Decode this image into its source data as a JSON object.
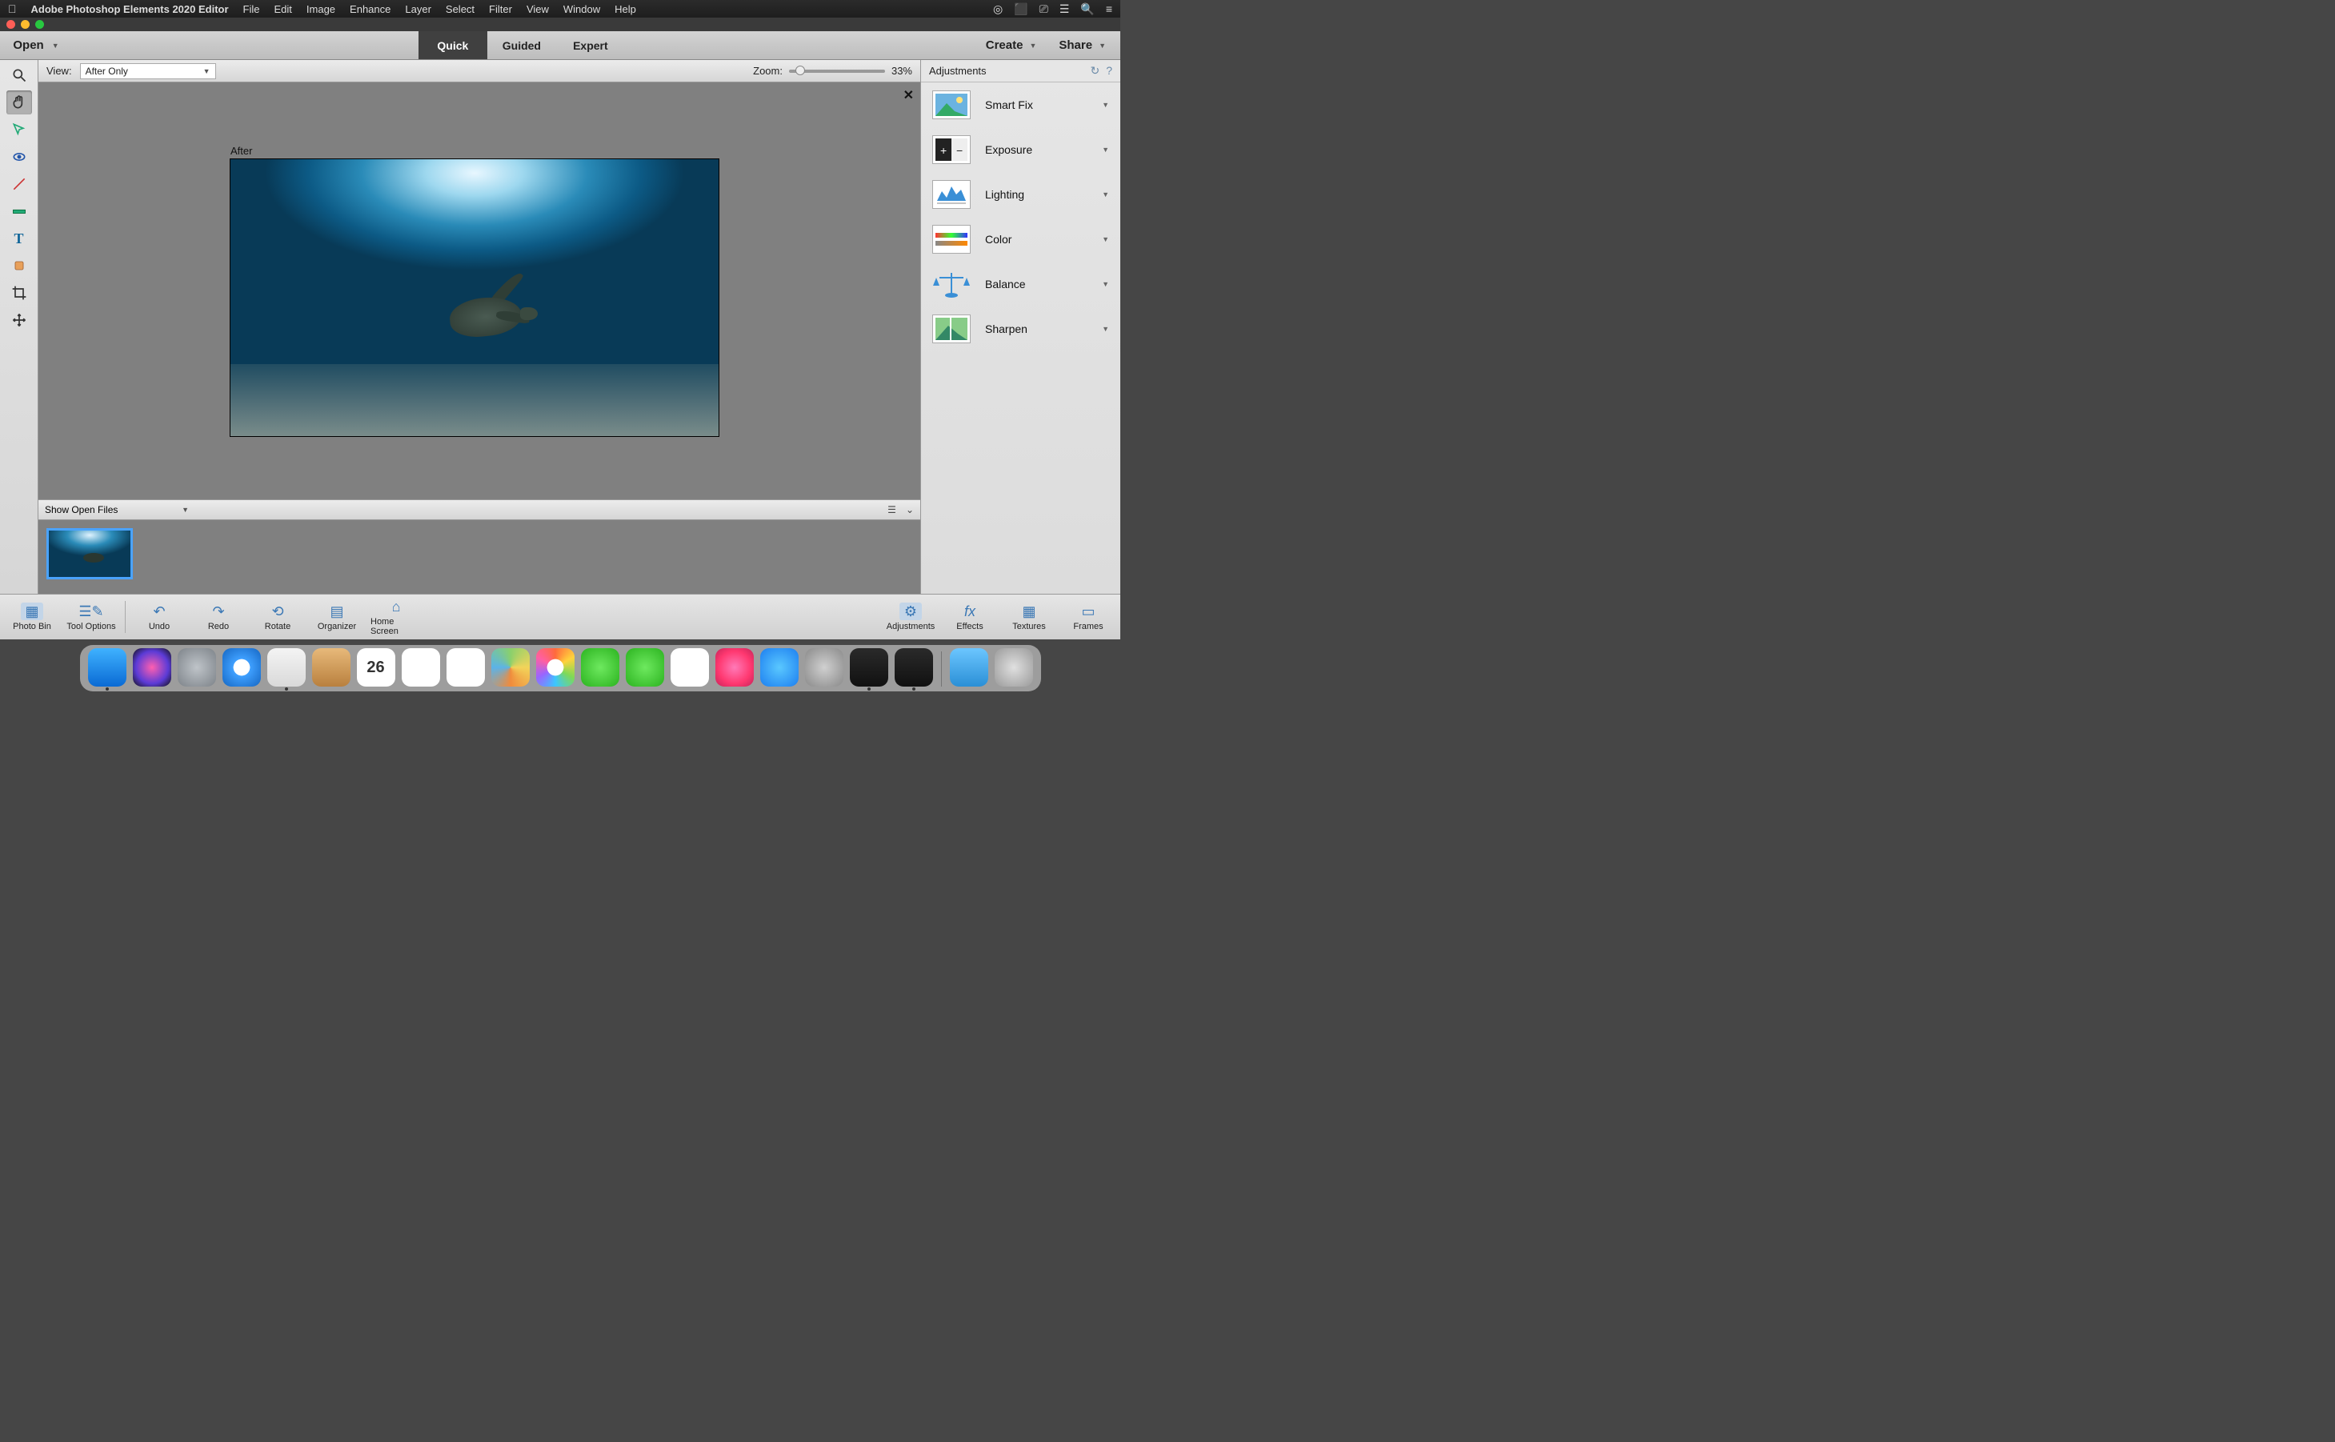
{
  "menubar": {
    "app_name": "Adobe Photoshop Elements 2020 Editor",
    "items": [
      "File",
      "Edit",
      "Image",
      "Enhance",
      "Layer",
      "Select",
      "Filter",
      "View",
      "Window",
      "Help"
    ]
  },
  "topbar": {
    "open": "Open",
    "tabs": {
      "quick": "Quick",
      "guided": "Guided",
      "expert": "Expert",
      "active": "quick"
    },
    "create": "Create",
    "share": "Share"
  },
  "optbar": {
    "view_label": "View:",
    "view_value": "After Only",
    "zoom_label": "Zoom:",
    "zoom_value": "33%"
  },
  "canvas": {
    "after_label": "After"
  },
  "adjustments": {
    "title": "Adjustments",
    "items": [
      "Smart Fix",
      "Exposure",
      "Lighting",
      "Color",
      "Balance",
      "Sharpen"
    ]
  },
  "binbar": {
    "select_label": "Show Open Files"
  },
  "bottom": {
    "left": [
      "Photo Bin",
      "Tool Options",
      "Undo",
      "Redo",
      "Rotate",
      "Organizer",
      "Home Screen"
    ],
    "right": [
      "Adjustments",
      "Effects",
      "Textures",
      "Frames"
    ]
  },
  "dock": {
    "apps": [
      {
        "name": "finder",
        "color": "linear-gradient(#3fb2ff,#0a6ad4)"
      },
      {
        "name": "siri",
        "color": "radial-gradient(circle at 50% 50%, #ff5fb0, #5b3bd6 60%, #111)"
      },
      {
        "name": "launchpad",
        "color": "radial-gradient(#bfc4c9,#7d8389)"
      },
      {
        "name": "safari",
        "color": "radial-gradient(#fff 30%, #3fa0ff 31%, #1566c2)"
      },
      {
        "name": "mail",
        "color": "linear-gradient(#f4f4f4,#d9d9d9)"
      },
      {
        "name": "contacts",
        "color": "linear-gradient(#e7b97a,#b9803e)"
      },
      {
        "name": "calendar",
        "color": "linear-gradient(#fff 30%,#fff), linear-gradient(#ff3b30,#ff3b30)",
        "text": "26"
      },
      {
        "name": "notes",
        "color": "linear-gradient(#fff 80%,#fff), linear-gradient(#ffd84d,#ffd84d)"
      },
      {
        "name": "reminders",
        "color": "#fff"
      },
      {
        "name": "maps",
        "color": "conic-gradient(#8ad06c, #f2d45a, #f08b3c, #5bb3e8, #8ad06c)"
      },
      {
        "name": "photos",
        "color": "radial-gradient(#fff 30%, transparent 31%), conic-gradient(#ff6a3c,#ffd23c,#7ed957,#3cc6ff,#9a64ff,#ff5fa2,#ff6a3c)"
      },
      {
        "name": "messages",
        "color": "radial-gradient(#6ee95f,#2bb31f)"
      },
      {
        "name": "facetime",
        "color": "radial-gradient(#6ee95f,#2bb31f)"
      },
      {
        "name": "news",
        "color": "linear-gradient(#fff,#fff)"
      },
      {
        "name": "music",
        "color": "radial-gradient(#ff7ab8,#ff3870 60%, #c4245a)"
      },
      {
        "name": "appstore",
        "color": "radial-gradient(#5ac8ff,#1d7ff0)"
      },
      {
        "name": "settings",
        "color": "radial-gradient(#d0d0d0,#8a8a8a)"
      },
      {
        "name": "pse-organizer",
        "color": "linear-gradient(#2a2a2a,#111)"
      },
      {
        "name": "pse-editor",
        "color": "linear-gradient(#2a2a2a,#111)"
      }
    ],
    "right": [
      {
        "name": "downloads",
        "color": "linear-gradient(#6cc6ff,#2a8fd6)"
      },
      {
        "name": "trash",
        "color": "radial-gradient(#e0e0e0,#9a9a9a)"
      }
    ]
  }
}
